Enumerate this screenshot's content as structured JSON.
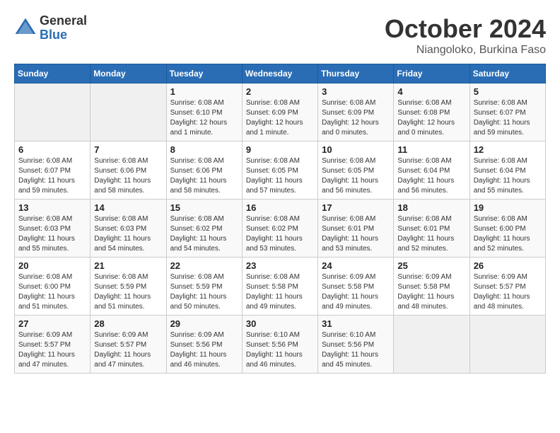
{
  "header": {
    "logo_general": "General",
    "logo_blue": "Blue",
    "month_title": "October 2024",
    "location": "Niangoloko, Burkina Faso"
  },
  "weekdays": [
    "Sunday",
    "Monday",
    "Tuesday",
    "Wednesday",
    "Thursday",
    "Friday",
    "Saturday"
  ],
  "weeks": [
    [
      {
        "day": "",
        "content": ""
      },
      {
        "day": "",
        "content": ""
      },
      {
        "day": "1",
        "content": "Sunrise: 6:08 AM\nSunset: 6:10 PM\nDaylight: 12 hours and 1 minute."
      },
      {
        "day": "2",
        "content": "Sunrise: 6:08 AM\nSunset: 6:09 PM\nDaylight: 12 hours and 1 minute."
      },
      {
        "day": "3",
        "content": "Sunrise: 6:08 AM\nSunset: 6:09 PM\nDaylight: 12 hours and 0 minutes."
      },
      {
        "day": "4",
        "content": "Sunrise: 6:08 AM\nSunset: 6:08 PM\nDaylight: 12 hours and 0 minutes."
      },
      {
        "day": "5",
        "content": "Sunrise: 6:08 AM\nSunset: 6:07 PM\nDaylight: 11 hours and 59 minutes."
      }
    ],
    [
      {
        "day": "6",
        "content": "Sunrise: 6:08 AM\nSunset: 6:07 PM\nDaylight: 11 hours and 59 minutes."
      },
      {
        "day": "7",
        "content": "Sunrise: 6:08 AM\nSunset: 6:06 PM\nDaylight: 11 hours and 58 minutes."
      },
      {
        "day": "8",
        "content": "Sunrise: 6:08 AM\nSunset: 6:06 PM\nDaylight: 11 hours and 58 minutes."
      },
      {
        "day": "9",
        "content": "Sunrise: 6:08 AM\nSunset: 6:05 PM\nDaylight: 11 hours and 57 minutes."
      },
      {
        "day": "10",
        "content": "Sunrise: 6:08 AM\nSunset: 6:05 PM\nDaylight: 11 hours and 56 minutes."
      },
      {
        "day": "11",
        "content": "Sunrise: 6:08 AM\nSunset: 6:04 PM\nDaylight: 11 hours and 56 minutes."
      },
      {
        "day": "12",
        "content": "Sunrise: 6:08 AM\nSunset: 6:04 PM\nDaylight: 11 hours and 55 minutes."
      }
    ],
    [
      {
        "day": "13",
        "content": "Sunrise: 6:08 AM\nSunset: 6:03 PM\nDaylight: 11 hours and 55 minutes."
      },
      {
        "day": "14",
        "content": "Sunrise: 6:08 AM\nSunset: 6:03 PM\nDaylight: 11 hours and 54 minutes."
      },
      {
        "day": "15",
        "content": "Sunrise: 6:08 AM\nSunset: 6:02 PM\nDaylight: 11 hours and 54 minutes."
      },
      {
        "day": "16",
        "content": "Sunrise: 6:08 AM\nSunset: 6:02 PM\nDaylight: 11 hours and 53 minutes."
      },
      {
        "day": "17",
        "content": "Sunrise: 6:08 AM\nSunset: 6:01 PM\nDaylight: 11 hours and 53 minutes."
      },
      {
        "day": "18",
        "content": "Sunrise: 6:08 AM\nSunset: 6:01 PM\nDaylight: 11 hours and 52 minutes."
      },
      {
        "day": "19",
        "content": "Sunrise: 6:08 AM\nSunset: 6:00 PM\nDaylight: 11 hours and 52 minutes."
      }
    ],
    [
      {
        "day": "20",
        "content": "Sunrise: 6:08 AM\nSunset: 6:00 PM\nDaylight: 11 hours and 51 minutes."
      },
      {
        "day": "21",
        "content": "Sunrise: 6:08 AM\nSunset: 5:59 PM\nDaylight: 11 hours and 51 minutes."
      },
      {
        "day": "22",
        "content": "Sunrise: 6:08 AM\nSunset: 5:59 PM\nDaylight: 11 hours and 50 minutes."
      },
      {
        "day": "23",
        "content": "Sunrise: 6:08 AM\nSunset: 5:58 PM\nDaylight: 11 hours and 49 minutes."
      },
      {
        "day": "24",
        "content": "Sunrise: 6:09 AM\nSunset: 5:58 PM\nDaylight: 11 hours and 49 minutes."
      },
      {
        "day": "25",
        "content": "Sunrise: 6:09 AM\nSunset: 5:58 PM\nDaylight: 11 hours and 48 minutes."
      },
      {
        "day": "26",
        "content": "Sunrise: 6:09 AM\nSunset: 5:57 PM\nDaylight: 11 hours and 48 minutes."
      }
    ],
    [
      {
        "day": "27",
        "content": "Sunrise: 6:09 AM\nSunset: 5:57 PM\nDaylight: 11 hours and 47 minutes."
      },
      {
        "day": "28",
        "content": "Sunrise: 6:09 AM\nSunset: 5:57 PM\nDaylight: 11 hours and 47 minutes."
      },
      {
        "day": "29",
        "content": "Sunrise: 6:09 AM\nSunset: 5:56 PM\nDaylight: 11 hours and 46 minutes."
      },
      {
        "day": "30",
        "content": "Sunrise: 6:10 AM\nSunset: 5:56 PM\nDaylight: 11 hours and 46 minutes."
      },
      {
        "day": "31",
        "content": "Sunrise: 6:10 AM\nSunset: 5:56 PM\nDaylight: 11 hours and 45 minutes."
      },
      {
        "day": "",
        "content": ""
      },
      {
        "day": "",
        "content": ""
      }
    ]
  ]
}
